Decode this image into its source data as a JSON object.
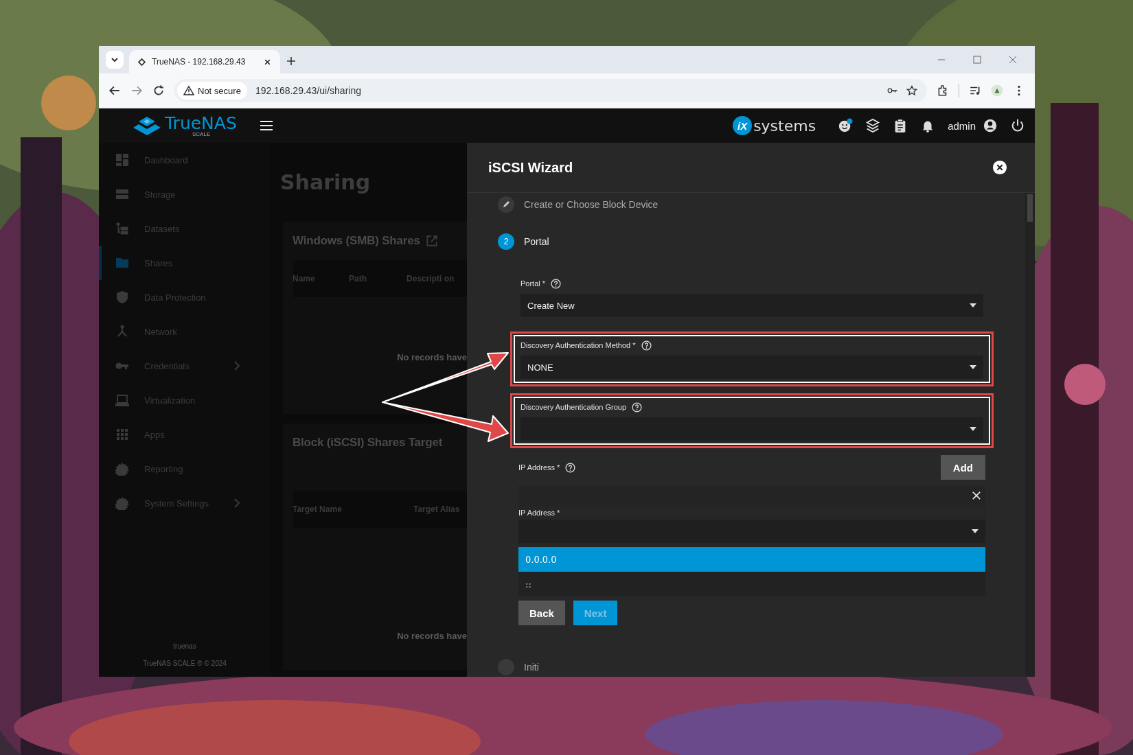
{
  "browser": {
    "tabs": [
      {
        "title": "TrueNAS - 192.168.29.43",
        "selected": true
      }
    ],
    "security": "Not secure",
    "url": "192.168.29.43/ui/sharing"
  },
  "app_header": {
    "brand": "TrueNAS",
    "brand_sub": "SCALE",
    "vendor_mark": "iX",
    "vendor": "systems",
    "user": "admin"
  },
  "sidebar": {
    "items": [
      {
        "label": "Dashboard",
        "selected": false,
        "has_children": false
      },
      {
        "label": "Storage",
        "selected": false,
        "has_children": false
      },
      {
        "label": "Datasets",
        "selected": false,
        "has_children": false
      },
      {
        "label": "Shares",
        "selected": true,
        "has_children": false
      },
      {
        "label": "Data Protection",
        "selected": false,
        "has_children": false
      },
      {
        "label": "Network",
        "selected": false,
        "has_children": false
      },
      {
        "label": "Credentials",
        "selected": false,
        "has_children": true
      },
      {
        "label": "Virtualization",
        "selected": false,
        "has_children": false
      },
      {
        "label": "Apps",
        "selected": false,
        "has_children": false
      },
      {
        "label": "Reporting",
        "selected": false,
        "has_children": false
      },
      {
        "label": "System Settings",
        "selected": false,
        "has_children": true
      }
    ],
    "footer": [
      "truenas",
      "TrueNAS SCALE ® © 2024"
    ]
  },
  "page": {
    "title": "Sharing",
    "cards": [
      {
        "title": "Windows (SMB) Shares",
        "columns": [
          "Name",
          "Path",
          "Descripti on"
        ],
        "empty": "No records have"
      },
      {
        "title": "Block (iSCSI) Shares Target",
        "columns": [
          "Target Name",
          "Target Alias"
        ],
        "empty": "No records have"
      }
    ]
  },
  "wizard": {
    "title": "iSCSI Wizard",
    "steps_before": [
      {
        "label": "Create or Choose Block Device"
      }
    ],
    "current_step": {
      "number": "2",
      "label": "Portal"
    },
    "fields": [
      {
        "label": "Portal *",
        "value": "Create New",
        "highlighted": false
      },
      {
        "label": "Discovery Authentication Method *",
        "value": "NONE",
        "highlighted": true
      },
      {
        "label": "Discovery Authentication Group",
        "highlighted": true
      }
    ],
    "ip_section": {
      "label": "IP Address *",
      "add_button": "Add",
      "entry_label": "IP Address *",
      "options": [
        {
          "label": "0.0.0.0",
          "selected": true
        },
        {
          "label": "::",
          "selected": false
        }
      ]
    },
    "buttons": [
      {
        "label": "Back",
        "kind": "secondary",
        "disabled": false
      },
      {
        "label": "Next",
        "kind": "primary",
        "disabled": true
      }
    ],
    "steps_after": [
      {
        "label": "Initi"
      }
    ]
  }
}
